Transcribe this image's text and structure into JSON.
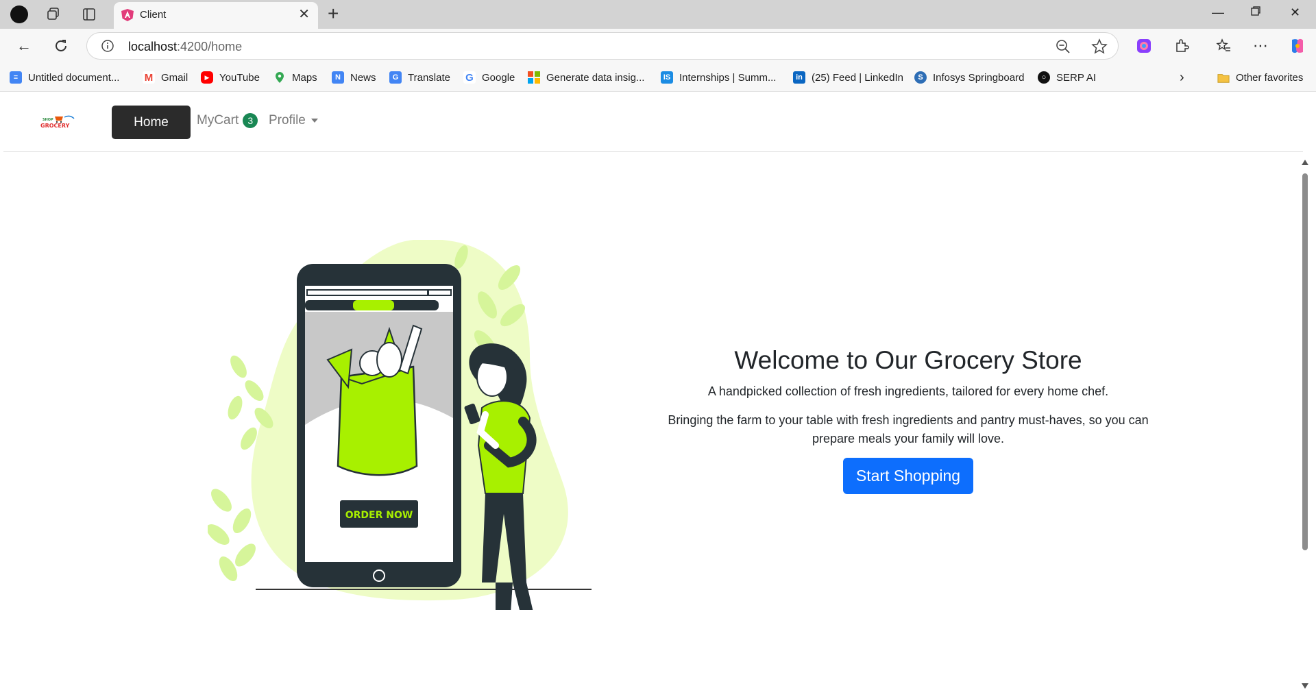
{
  "browser": {
    "tab_title": "Client",
    "url_host": "localhost",
    "url_rest": ":4200/home",
    "bookmarks": [
      {
        "label": "Untitled document...",
        "icon": "docs-icon",
        "color": "#4285f4"
      },
      {
        "label": "Gmail",
        "icon": "gmail-icon",
        "color": "#ea4335"
      },
      {
        "label": "YouTube",
        "icon": "youtube-icon",
        "color": "#ff0000"
      },
      {
        "label": "Maps",
        "icon": "maps-icon",
        "color": "#34a853"
      },
      {
        "label": "News",
        "icon": "news-icon",
        "color": "#4285f4"
      },
      {
        "label": "Translate",
        "icon": "translate-icon",
        "color": "#4285f4"
      },
      {
        "label": "Google",
        "icon": "google-icon",
        "color": "#4285f4"
      },
      {
        "label": "Generate data insig...",
        "icon": "microsoft-icon",
        "color": "#f25022"
      },
      {
        "label": "Internships | Summ...",
        "icon": "internshala-icon",
        "color": "#1b8ce3"
      },
      {
        "label": "(25) Feed | LinkedIn",
        "icon": "linkedin-icon",
        "color": "#0a66c2"
      },
      {
        "label": "Infosys Springboard",
        "icon": "infosys-icon",
        "color": "#2d6db5"
      },
      {
        "label": "SERP AI",
        "icon": "serp-icon",
        "color": "#111111"
      }
    ],
    "other_favorites": "Other favorites"
  },
  "nav": {
    "logo_text_top": "SHOP",
    "logo_text": "GROCERY",
    "home": "Home",
    "mycart": "MyCart",
    "cart_count": "3",
    "profile": "Profile"
  },
  "hero": {
    "title": "Welcome to Our Grocery Store",
    "lead": "A handpicked collection of fresh ingredients, tailored for every home chef.",
    "body": "Bringing the farm to your table with fresh ingredients and pantry must-haves, so you can prepare meals your family will love.",
    "cta": "Start Shopping",
    "illustration_button": "ORDER NOW"
  },
  "colors": {
    "accent_green": "#a8f000",
    "primary_blue": "#0d6efd",
    "badge_green": "#198754",
    "dark": "#2b2b2b"
  }
}
